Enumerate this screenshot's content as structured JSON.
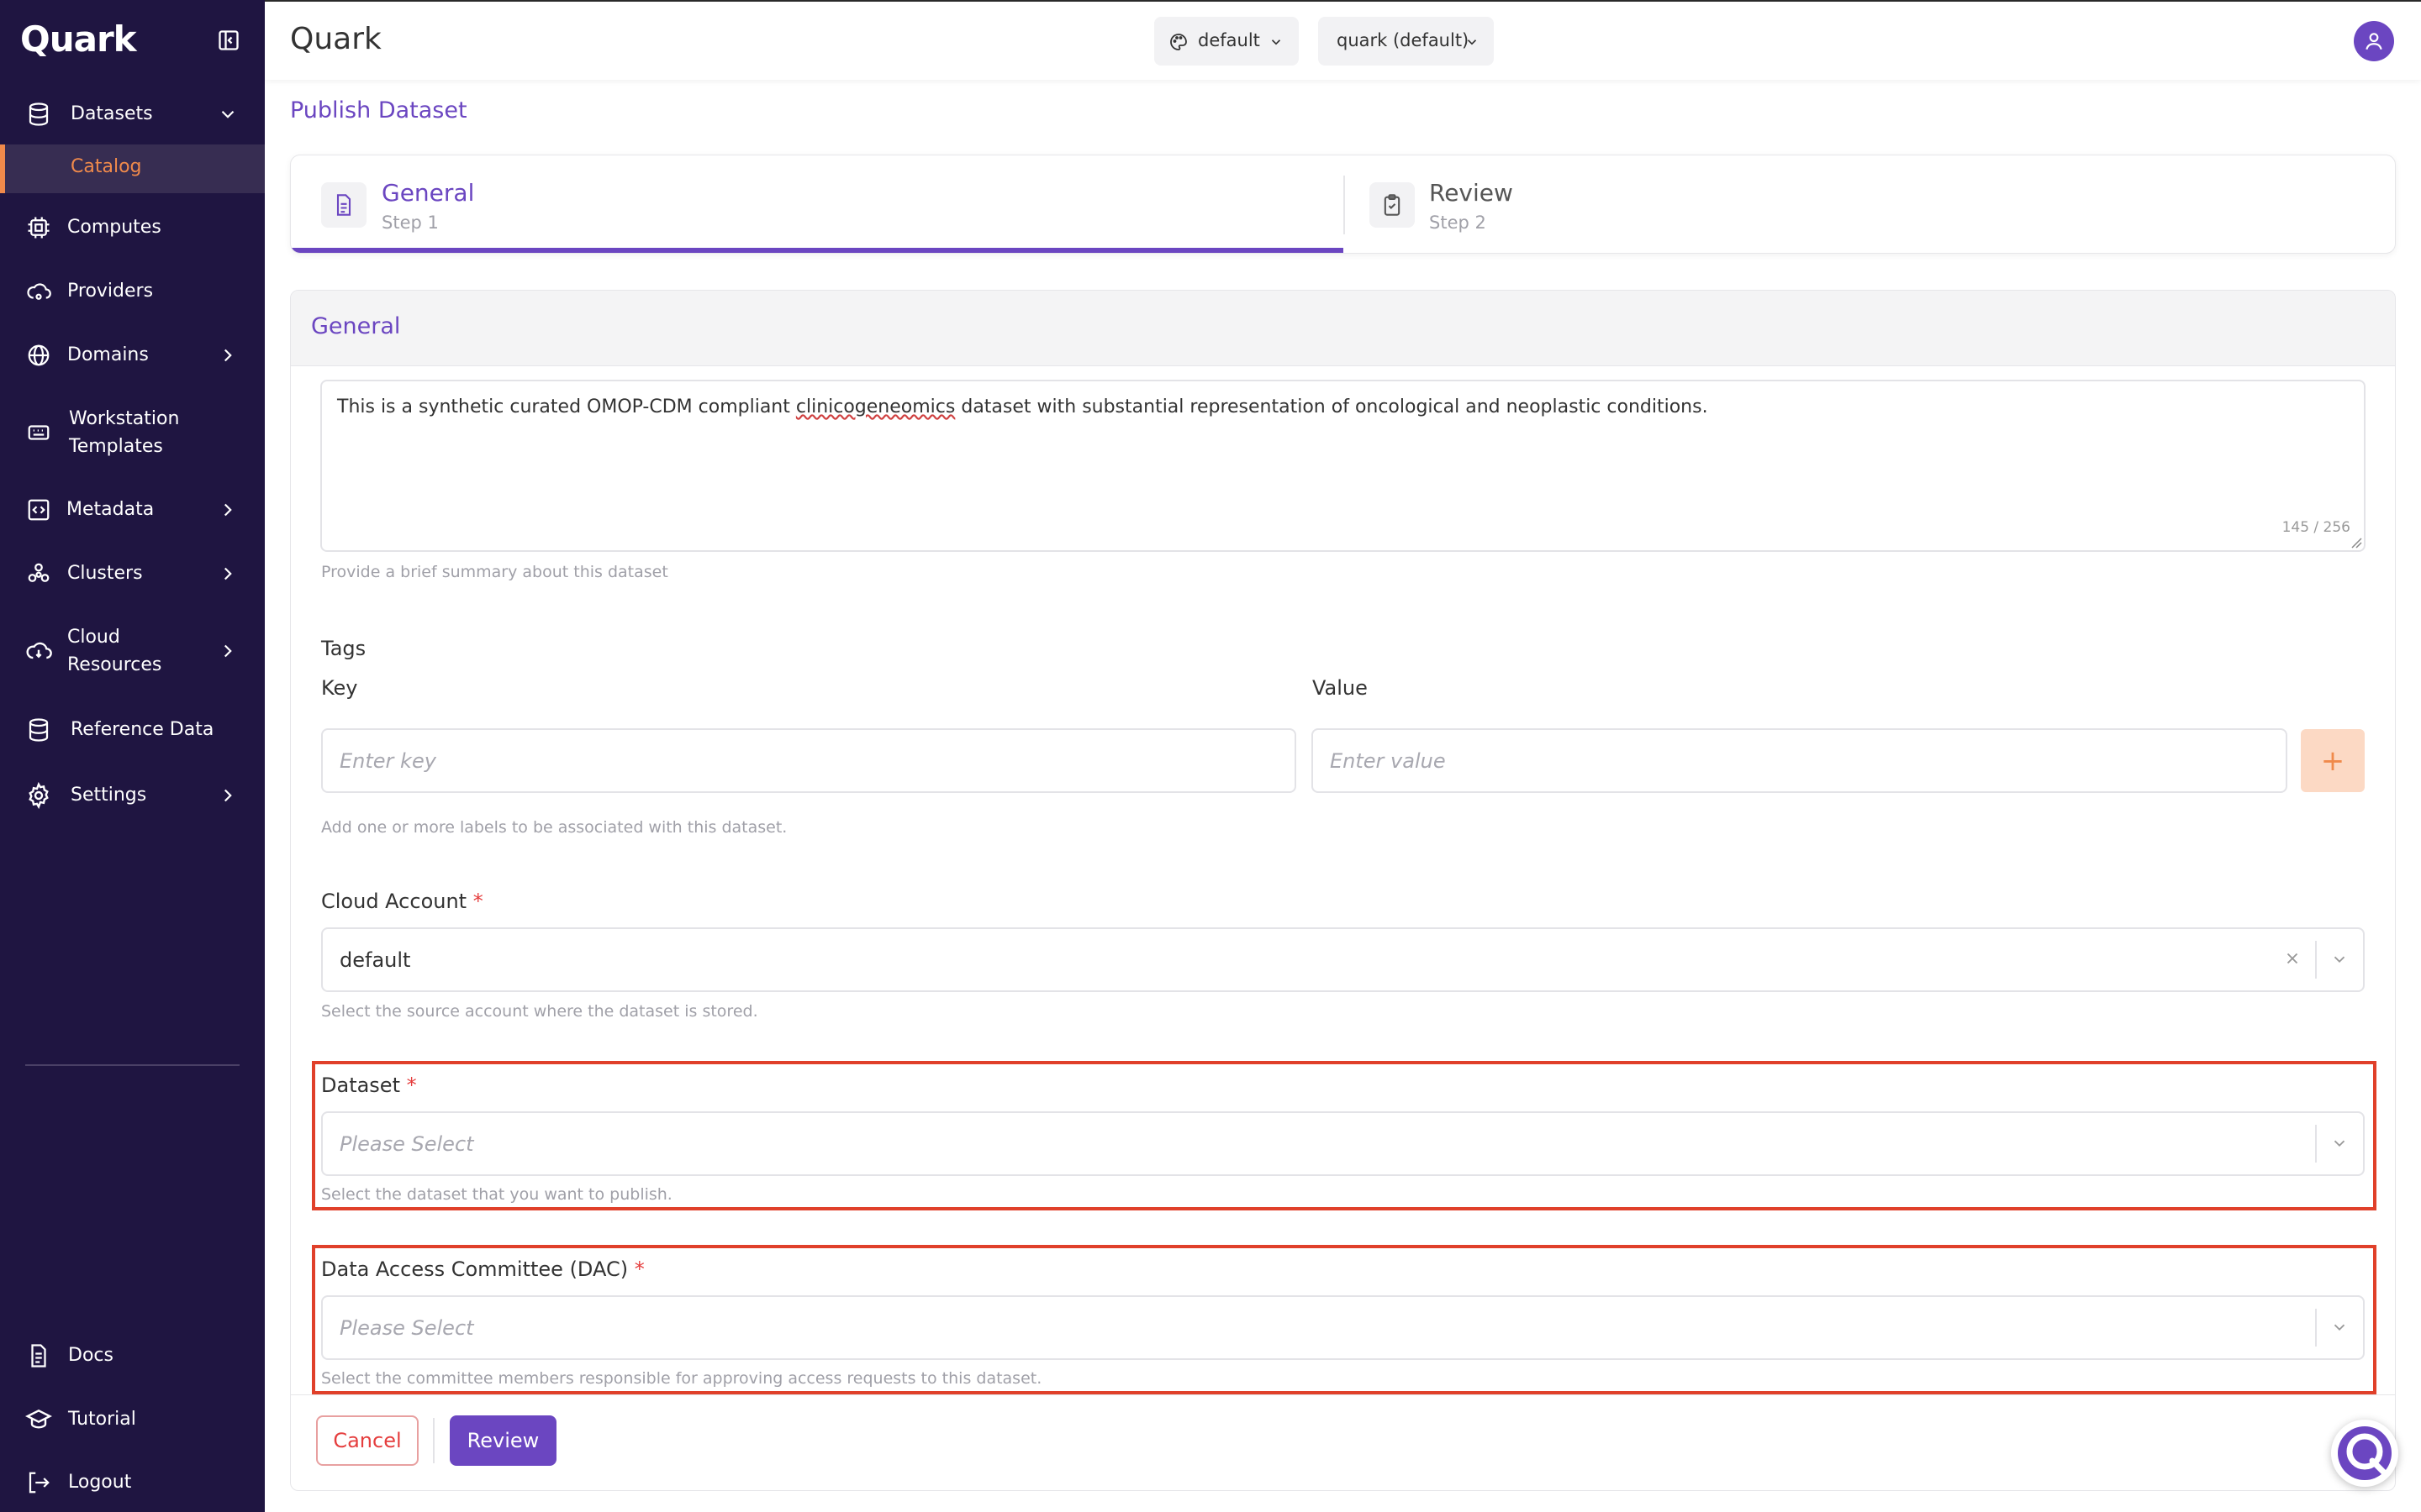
{
  "sidebar": {
    "brand": "Quark",
    "items": {
      "datasets": "Datasets",
      "catalog": "Catalog",
      "computes": "Computes",
      "providers": "Providers",
      "domains": "Domains",
      "workstation_l1": "Workstation",
      "workstation_l2": "Templates",
      "metadata": "Metadata",
      "clusters": "Clusters",
      "cloud_l1": "Cloud",
      "cloud_l2": "Resources",
      "reference": "Reference Data",
      "settings": "Settings",
      "docs": "Docs",
      "tutorial": "Tutorial",
      "logout": "Logout"
    },
    "colors": {
      "background": "#1f1541",
      "active": "#f08a4b"
    }
  },
  "header": {
    "title": "Quark",
    "theme_label": "default",
    "workspace_label": "quark (default)"
  },
  "page": {
    "title": "Publish Dataset",
    "steps": [
      {
        "title": "General",
        "sub": "Step 1"
      },
      {
        "title": "Review",
        "sub": "Step 2"
      }
    ],
    "section_title": "General"
  },
  "form": {
    "description": {
      "before": "This is a synthetic curated OMOP-CDM compliant ",
      "flagged": "clinicogeneomics",
      "after": " dataset with substantial representation of oncological and neoplastic conditions.",
      "counter": "145 / 256",
      "help": "Provide a brief summary about this dataset"
    },
    "tags": {
      "label": "Tags",
      "key_label": "Key",
      "value_label": "Value",
      "key_placeholder": "Enter key",
      "value_placeholder": "Enter value",
      "add": "+",
      "help": "Add one or more labels to be associated with this dataset."
    },
    "cloud_account": {
      "label": "Cloud Account",
      "value": "default",
      "help": "Select the source account where the dataset is stored."
    },
    "dataset": {
      "label": "Dataset",
      "placeholder": "Please Select",
      "help": "Select the dataset that you want to publish."
    },
    "dac": {
      "label": "Data Access Committee (DAC)",
      "placeholder": "Please Select",
      "help": "Select the committee members responsible for approving access requests to this dataset."
    },
    "required_mark": "*"
  },
  "actions": {
    "cancel": "Cancel",
    "review": "Review"
  },
  "icons": [
    "collapse-sidebar-icon",
    "database-icon",
    "cpu-icon",
    "cloud-provider-icon",
    "globe-icon",
    "keyboard-icon",
    "code-icon",
    "cluster-icon",
    "cloud-icon",
    "settings-icon",
    "document-icon",
    "graduation-cap-icon",
    "logout-icon",
    "palette-icon",
    "user-icon",
    "clipboard-check-icon",
    "help-chat-icon"
  ],
  "theme": {
    "accent": "#6b46c1",
    "orange": "#f08a4b",
    "highlight": "#e0402a"
  }
}
